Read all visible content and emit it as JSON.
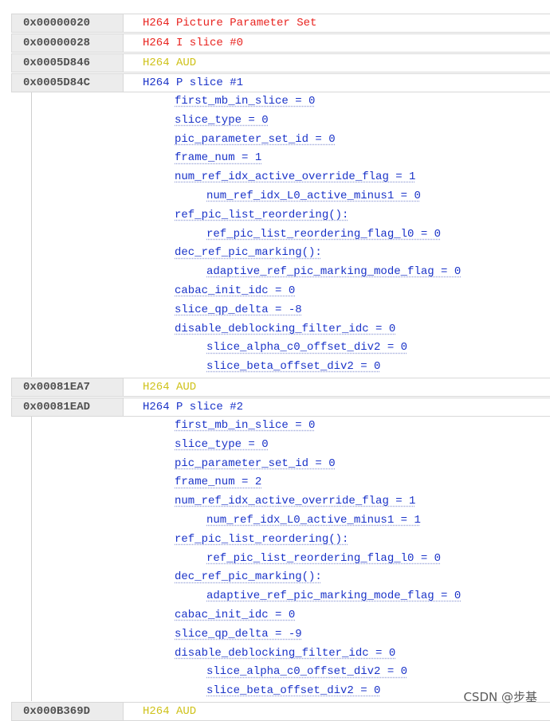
{
  "rows": [
    {
      "addr": "0x00000020",
      "desc": "H264 Picture Parameter Set",
      "color": "#e8231f"
    },
    {
      "addr": "0x00000028",
      "desc": "H264 I slice #0",
      "color": "#e8231f"
    },
    {
      "addr": "0x0005D846",
      "desc": "H264 AUD",
      "color": "#cfc21a"
    },
    {
      "addr": "0x0005D84C",
      "desc": "H264 P slice #1",
      "color": "#1a33c8"
    },
    {
      "addr": "0x00081EA7",
      "desc": "H264 AUD",
      "color": "#cfc21a"
    },
    {
      "addr": "0x00081EAD",
      "desc": "H264 P slice #2",
      "color": "#1a33c8"
    },
    {
      "addr": "0x000B369D",
      "desc": "H264 AUD",
      "color": "#cfc21a"
    }
  ],
  "slice1_fields": [
    "first_mb_in_slice = 0",
    "slice_type = 0",
    "pic_parameter_set_id = 0",
    "frame_num = 1",
    "num_ref_idx_active_override_flag = 1",
    "num_ref_idx_L0_active_minus1 = 0",
    "ref_pic_list_reordering():",
    "ref_pic_list_reordering_flag_l0 = 0",
    "dec_ref_pic_marking():",
    "adaptive_ref_pic_marking_mode_flag = 0",
    "cabac_init_idc = 0",
    "slice_qp_delta = -8",
    "disable_deblocking_filter_idc = 0",
    "slice_alpha_c0_offset_div2 = 0",
    "slice_beta_offset_div2 = 0"
  ],
  "slice2_fields": [
    "first_mb_in_slice = 0",
    "slice_type = 0",
    "pic_parameter_set_id = 0",
    "frame_num = 2",
    "num_ref_idx_active_override_flag = 1",
    "num_ref_idx_L0_active_minus1 = 1",
    "ref_pic_list_reordering():",
    "ref_pic_list_reordering_flag_l0 = 0",
    "dec_ref_pic_marking():",
    "adaptive_ref_pic_marking_mode_flag = 0",
    "cabac_init_idc = 0",
    "slice_qp_delta = -9",
    "disable_deblocking_filter_idc = 0",
    "slice_alpha_c0_offset_div2 = 0",
    "slice_beta_offset_div2 = 0"
  ],
  "watermark": "CSDN @步基"
}
